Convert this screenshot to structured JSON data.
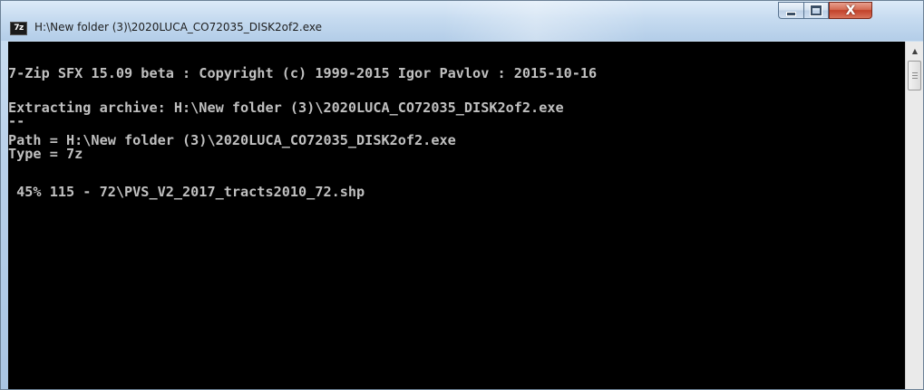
{
  "window": {
    "icon_label": "7z",
    "title": "H:\\New folder (3)\\2020LUCA_CO72035_DISK2of2.exe",
    "controls": {
      "minimize_icon": "minimize-icon",
      "maximize_icon": "maximize-icon",
      "close_icon": "close-icon",
      "close_glyph": "X"
    }
  },
  "console": {
    "lines": [
      "7-Zip SFX 15.09 beta : Copyright (c) 1999-2015 Igor Pavlov : 2015-10-16",
      "Extracting archive: H:\\New folder (3)\\2020LUCA_CO72035_DISK2of2.exe",
      "--",
      "Path = H:\\New folder (3)\\2020LUCA_CO72035_DISK2of2.exe",
      "Type = 7z",
      " 45% 115 - 72\\PVS_V2_2017_tracts2010_72.shp"
    ],
    "text_color": "#c0c0c0",
    "background": "#000000"
  },
  "scrollbar": {
    "up_arrow_icon": "chevron-up-icon",
    "up_glyph": "▲"
  }
}
